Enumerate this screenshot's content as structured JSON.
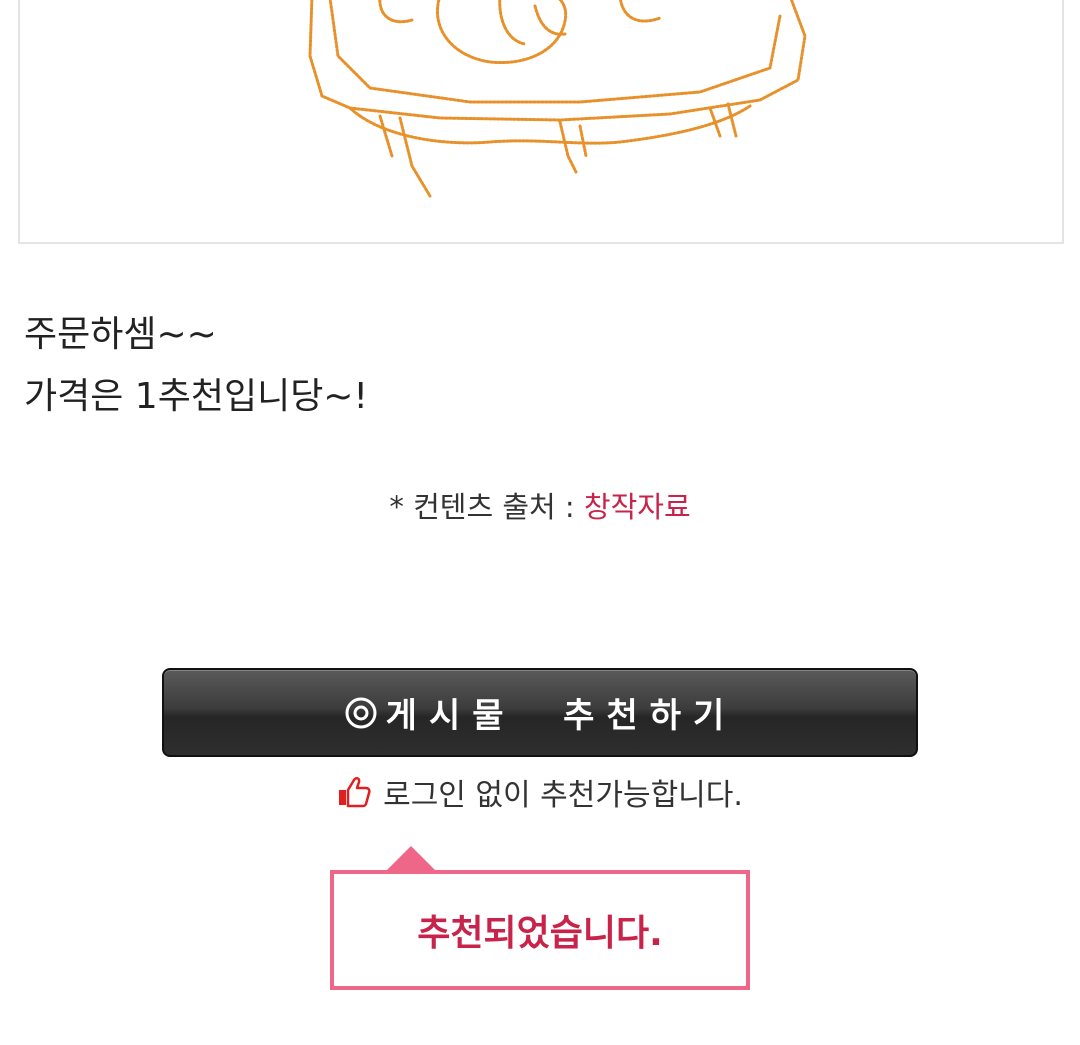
{
  "post": {
    "lines": [
      "주문하셈~~",
      "가격은 1추천입니당~!"
    ]
  },
  "source": {
    "prefix": "* 컨텐츠 출처 : ",
    "link": "창작자료",
    "link_color": "#c8234a"
  },
  "recommend": {
    "button_label": "게시물  추천하기",
    "icon": "target-circle-icon",
    "hint": "로그인 없이 추천가능합니다.",
    "hint_icon": "thumbs-up-icon"
  },
  "popup": {
    "message": "추천되었습니다.",
    "border_color": "#ee6688",
    "text_color": "#c8234a"
  },
  "illustration": {
    "description_icon": "sketch-illustration",
    "stroke_color": "#e8902a"
  }
}
